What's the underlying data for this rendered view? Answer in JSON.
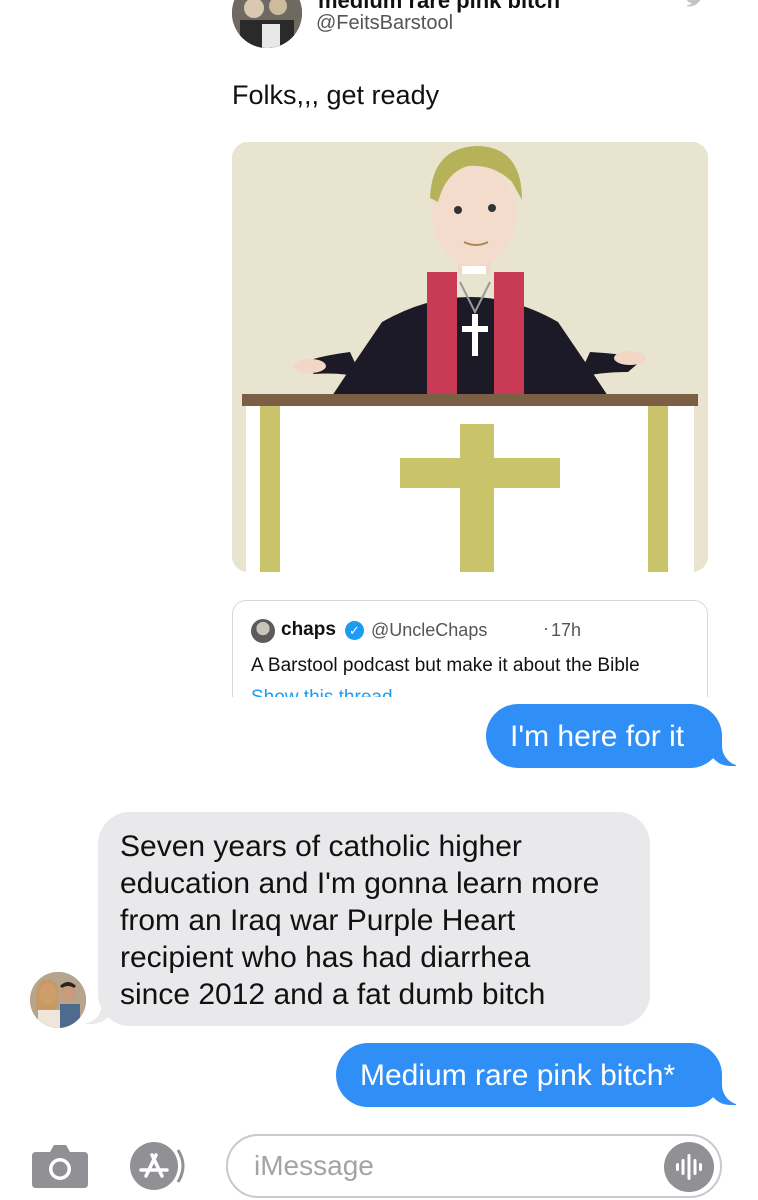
{
  "tweet": {
    "display_name": "medium rare pink bitch",
    "handle": "@FeitsBarstool",
    "text": "Folks,,, get ready",
    "quoted": {
      "name": "chaps",
      "handle": "@UncleChaps",
      "separator": "·",
      "time": "17h",
      "text": "A Barstool podcast but make it about the Bible",
      "link": "Show this thread"
    }
  },
  "messages": [
    {
      "direction": "sent",
      "text": "I'm here for it"
    },
    {
      "direction": "received",
      "text_lines": [
        "Seven years of catholic higher",
        "education and I'm gonna learn more",
        "from an Iraq war Purple Heart",
        "recipient who has had diarrhea",
        "since 2012 and a fat dumb bitch"
      ]
    },
    {
      "direction": "sent",
      "text": "Medium rare pink bitch*"
    }
  ],
  "input": {
    "placeholder": "iMessage"
  },
  "icons": {
    "camera": "camera-icon",
    "apps": "app-store-icon",
    "audio": "waveform-icon",
    "verified": "verified-badge-icon"
  },
  "colors": {
    "sent_bubble": "#2f8ff7",
    "received_bubble": "#e9e9eb",
    "link": "#1d9bf0",
    "icon_gray": "#909095"
  }
}
